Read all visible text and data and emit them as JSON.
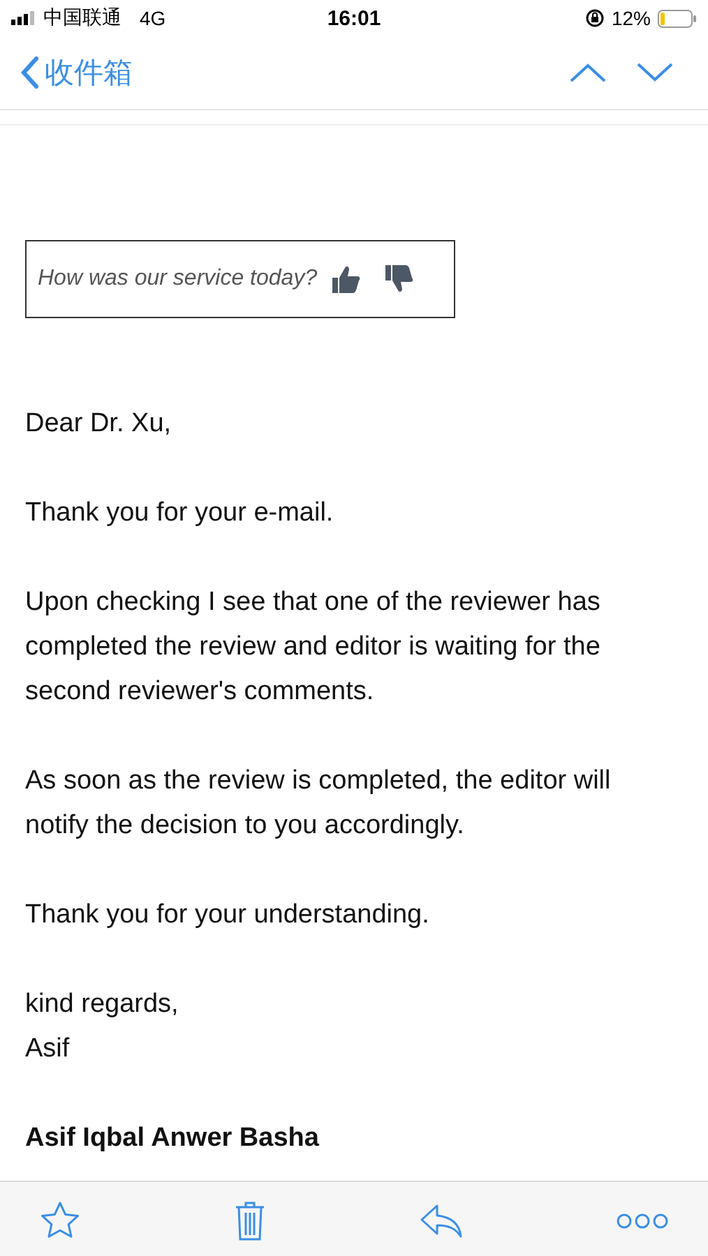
{
  "status_bar": {
    "carrier": "中国联通",
    "network": "4G",
    "time": "16:01",
    "battery": "12%"
  },
  "nav": {
    "back": "收件箱"
  },
  "survey": {
    "question": "How was our service today?"
  },
  "body": [
    "Dear Dr. Xu,",
    "Thank you for your e-mail.",
    "Upon checking I see that one of the reviewer has completed the review and editor is waiting for the second reviewer's comments.",
    "As soon as the review is completed, the editor will notify the decision to you accordingly.",
    "Thank you for your understanding."
  ],
  "closing": [
    "kind regards,",
    "Asif"
  ],
  "signature": {
    "name": "Asif Iqbal Anwer Basha"
  }
}
